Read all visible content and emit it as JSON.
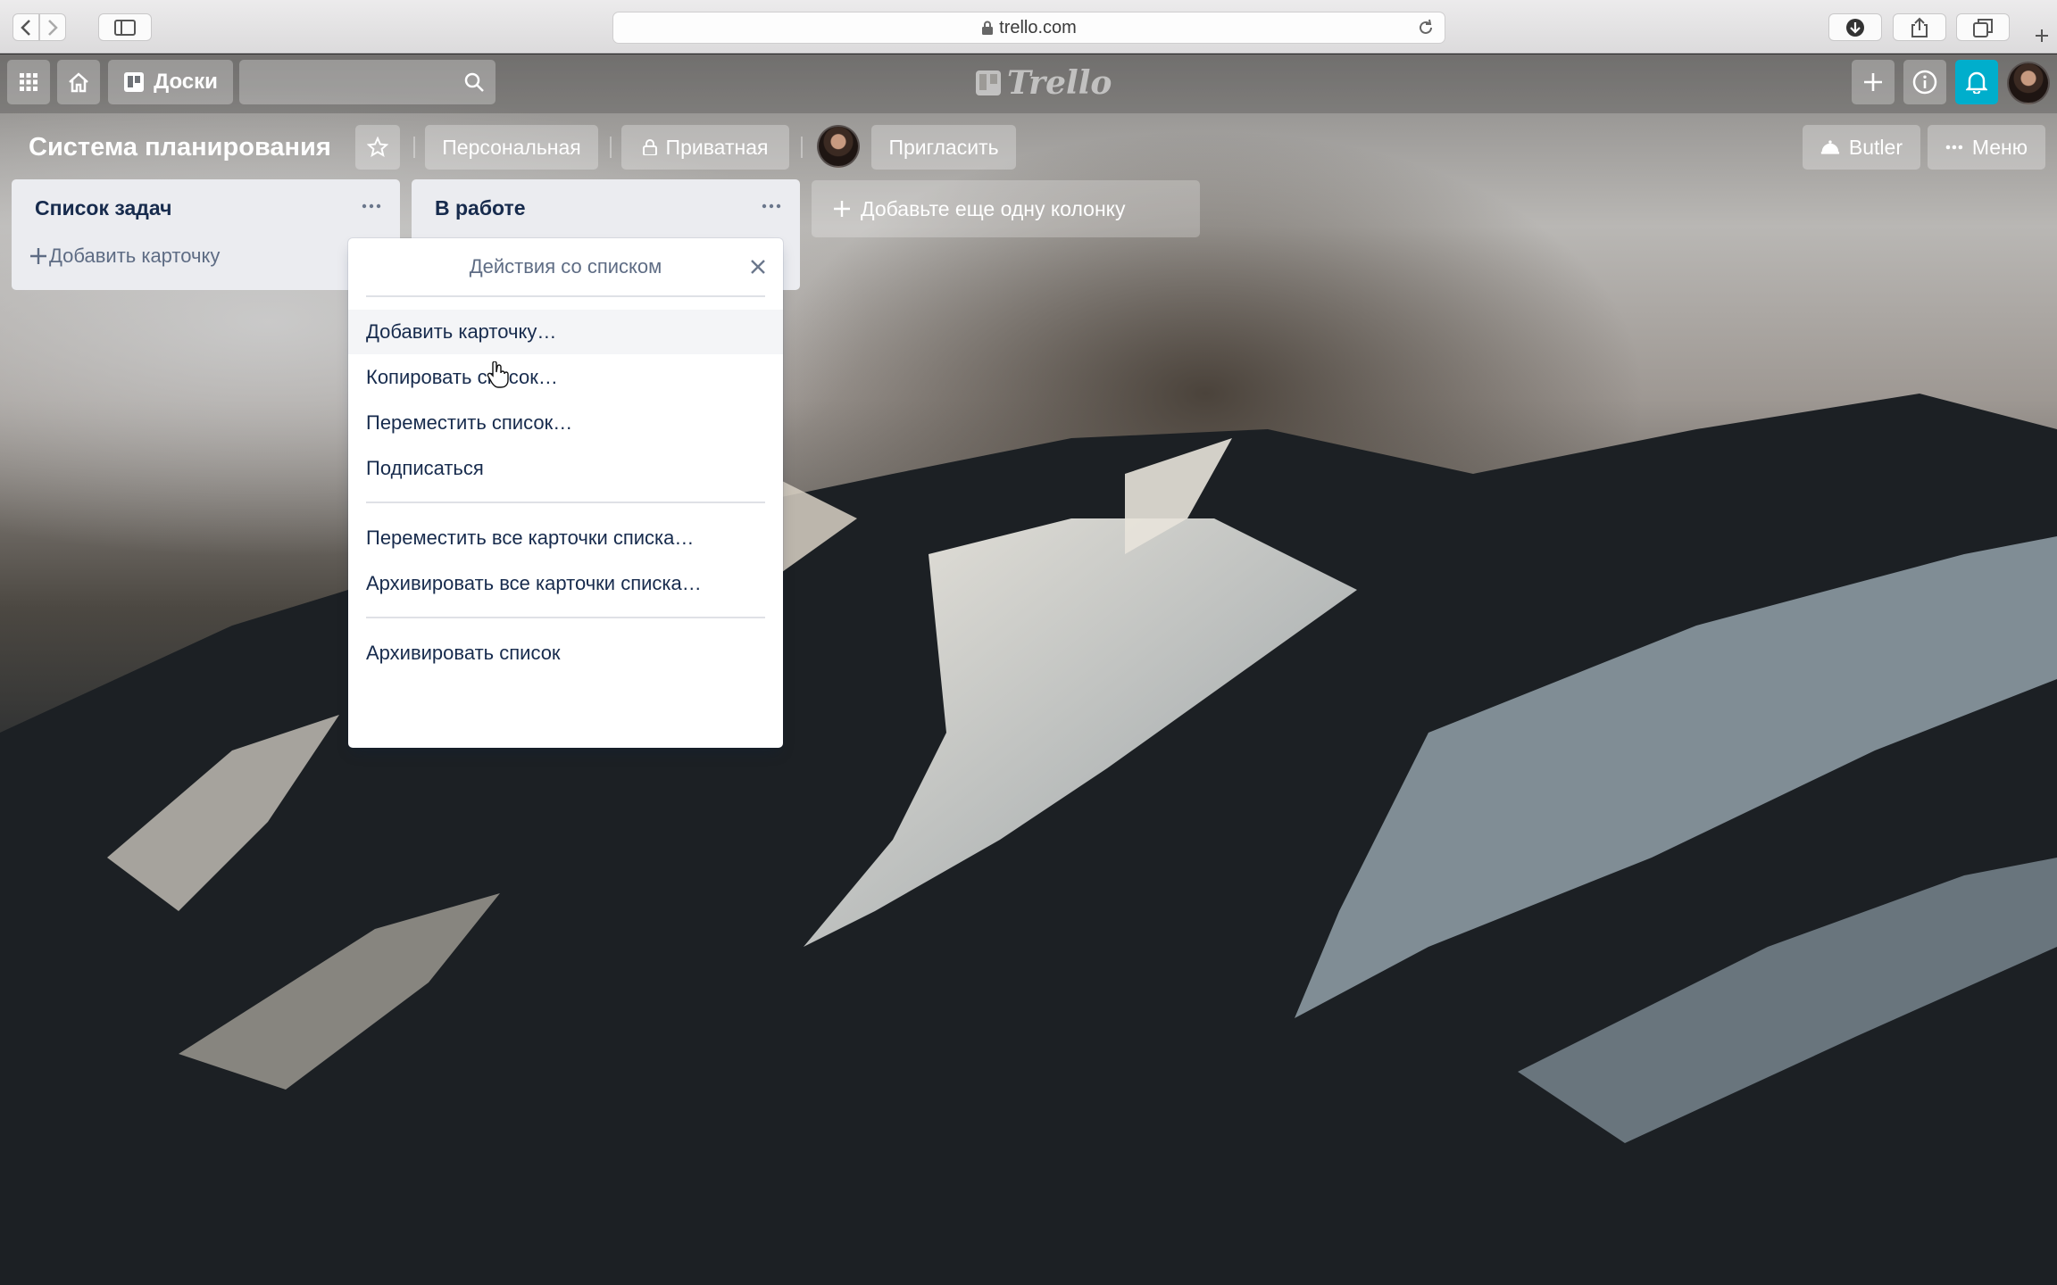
{
  "browser": {
    "url": "trello.com"
  },
  "header": {
    "boards_label": "Доски",
    "search_value": "",
    "logo_text": "Trello"
  },
  "board": {
    "title": "Система планирования",
    "team_label": "Персональная",
    "visibility_label": "Приватная",
    "invite_label": "Пригласить",
    "butler_label": "Butler",
    "menu_label": "Меню"
  },
  "lists": [
    {
      "title": "Список задач",
      "add_card_label": "Добавить карточку"
    },
    {
      "title": "В работе"
    }
  ],
  "add_list_label": "Добавьте еще одну колонку",
  "popover": {
    "title": "Действия со списком",
    "groups": [
      [
        "Добавить карточку…",
        "Копировать список…",
        "Переместить список…",
        "Подписаться"
      ],
      [
        "Переместить все карточки списка…",
        "Архивировать все карточки списка…"
      ],
      [
        "Архивировать список"
      ]
    ]
  },
  "colors": {
    "list_bg": "#ebecf0",
    "text_dark": "#172b4d",
    "text_muted": "#5e6c84",
    "notification_accent": "#00aecc"
  }
}
